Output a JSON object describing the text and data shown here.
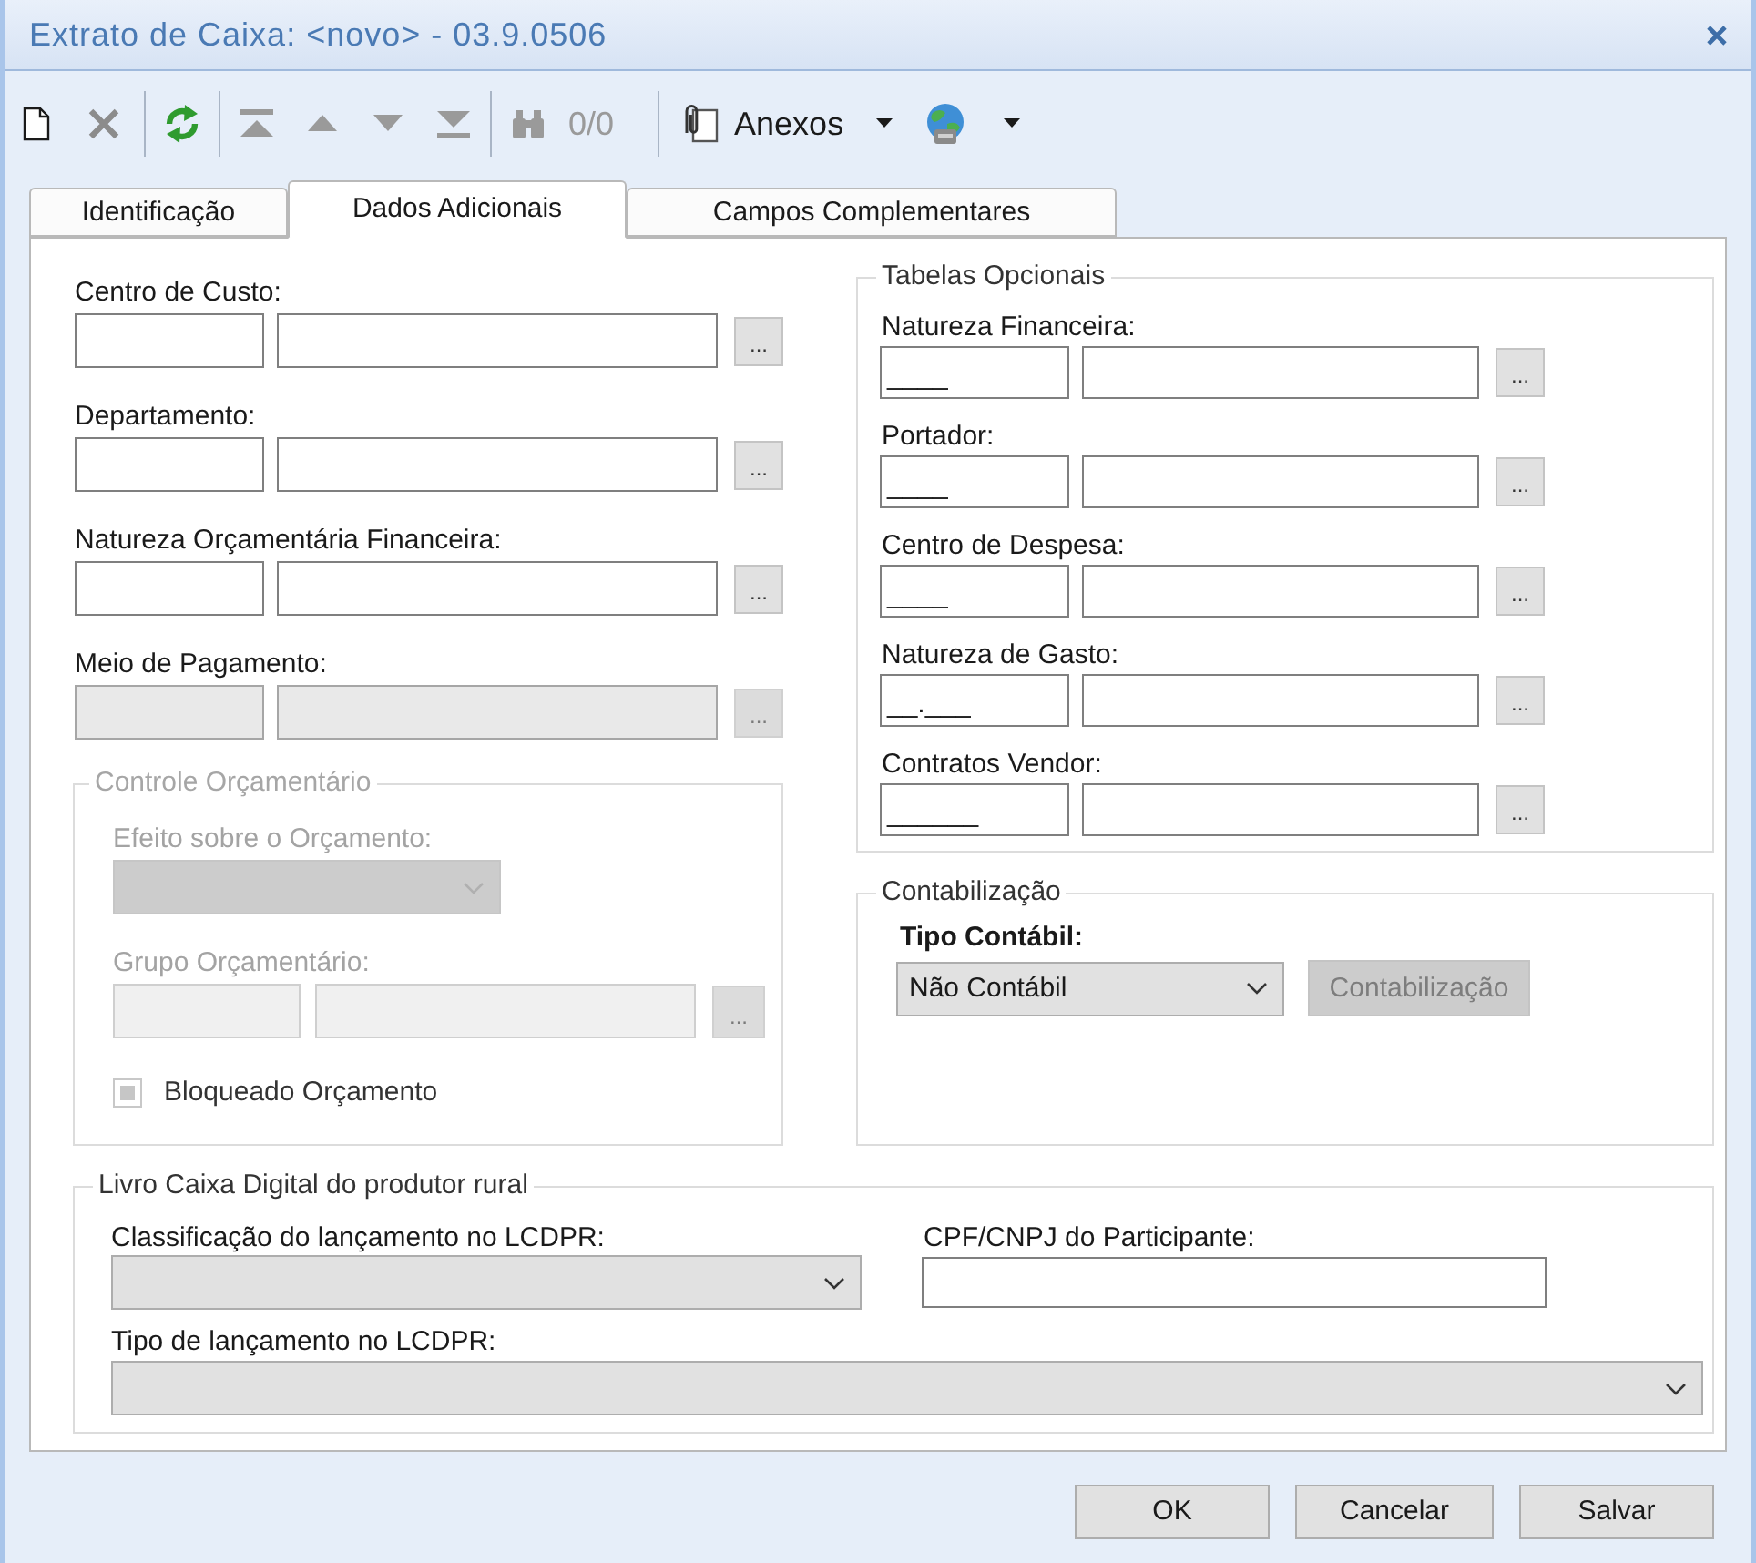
{
  "window": {
    "title": "Extrato de Caixa: <novo> - 03.9.0506"
  },
  "toolbar": [
    {
      "kind": "new",
      "disabled": false
    },
    {
      "kind": "delete",
      "disabled": true
    },
    {
      "kind": "separator"
    },
    {
      "kind": "refresh",
      "disabled": false
    },
    {
      "kind": "separator"
    },
    {
      "kind": "first",
      "disabled": true
    },
    {
      "kind": "previous",
      "disabled": true
    },
    {
      "kind": "next",
      "disabled": true
    },
    {
      "kind": "last",
      "disabled": true
    },
    {
      "kind": "separator"
    },
    {
      "kind": "find",
      "disabled": true
    },
    {
      "kind": "counter",
      "text": "0/0",
      "disabled": true
    },
    {
      "kind": "separator"
    },
    {
      "kind": "attachments",
      "label": "Anexos",
      "dropdown": true
    },
    {
      "kind": "globe",
      "dropdown": true
    }
  ],
  "tabs": [
    {
      "label": "Identificação",
      "selected": false
    },
    {
      "label": "Dados Adicionais",
      "selected": true
    },
    {
      "label": "Campos Complementares",
      "selected": false
    }
  ],
  "lookups": [
    {
      "label": "Centro de Custo:",
      "button": "...",
      "disabled": false
    },
    {
      "label": "Departamento:",
      "button": "...",
      "disabled": false
    },
    {
      "label": "Natureza Orçamentária Financeira:",
      "button": "...",
      "disabled": false
    },
    {
      "label": "Meio de Pagamento:",
      "button": "...",
      "disabled": true
    }
  ],
  "budget_control": {
    "title": "Controle Orçamentário",
    "disabled": true,
    "effect_label": "Efeito sobre o Orçamento:",
    "group_label": "Grupo Orçamentário:",
    "group_button": "...",
    "blocked": {
      "label": "Bloqueado Orçamento",
      "indeterminate": true
    }
  },
  "optional_tables": {
    "title": "Tabelas Opcionais",
    "fields": [
      {
        "label": "Natureza Financeira:",
        "code": "____",
        "button": "..."
      },
      {
        "label": "Portador:",
        "code": "____",
        "button": "..."
      },
      {
        "label": "Centro de Despesa:",
        "code": "____",
        "button": "..."
      },
      {
        "label": "Natureza de Gasto:",
        "code": "__.___",
        "button": "..."
      },
      {
        "label": "Contratos Vendor:",
        "code": "______",
        "button": "..."
      }
    ]
  },
  "accounting": {
    "title": "Contabilização",
    "type_label": "Tipo Contábil:",
    "type_value": "Não Contábil",
    "button": {
      "label": "Contabilização",
      "disabled": true
    }
  },
  "lcdpr": {
    "title": "Livro Caixa Digital do produtor rural",
    "classification_label": "Classificação do lançamento no LCDPR:",
    "participant_label": "CPF/CNPJ do Participante:",
    "entry_type_label": "Tipo de lançamento no LCDPR:"
  },
  "buttons": [
    {
      "label": "OK"
    },
    {
      "label": "Cancelar"
    },
    {
      "label": "Salvar"
    }
  ]
}
